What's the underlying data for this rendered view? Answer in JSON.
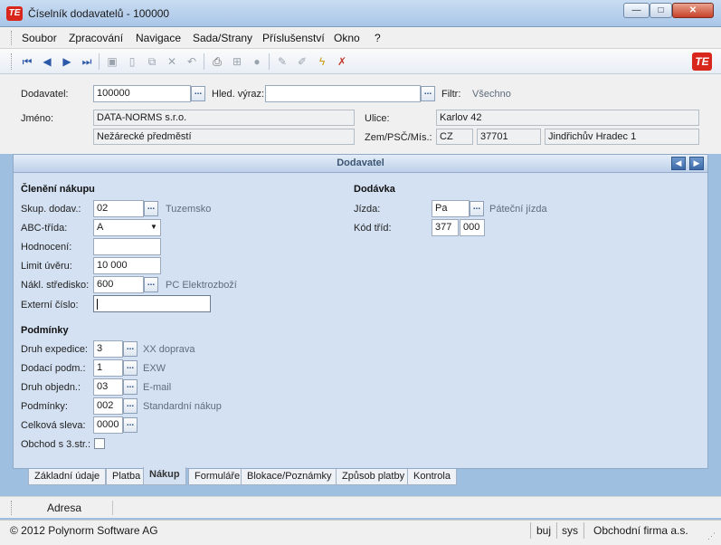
{
  "window": {
    "title": "Číselník dodavatelů - 100000",
    "logo": "TE",
    "minimize": "—",
    "maximize": "□",
    "close": "✕"
  },
  "menu": [
    "Soubor",
    "Zpracování",
    "Navigace",
    "Sada/Strany",
    "Příslušenství",
    "Okno",
    "?"
  ],
  "toolbar": {
    "icons": [
      "first-record-icon",
      "prev-record-icon",
      "next-record-icon",
      "last-record-icon",
      "save-icon",
      "new-icon",
      "copy-icon",
      "delete-icon",
      "undo-icon",
      "print-icon",
      "tree-icon",
      "disc-icon",
      "edit-icon",
      "edit2-icon",
      "magic-icon",
      "cancel-filter-icon"
    ]
  },
  "header": {
    "dodavatel_label": "Dodavatel:",
    "dodavatel_value": "100000",
    "hled_label": "Hled. výraz:",
    "hled_value": "",
    "filtr_label": "Filtr:",
    "filtr_value": "Všechno",
    "jmeno_label": "Jméno:",
    "jmeno_line1": "DATA-NORMS s.r.o.",
    "jmeno_line2": "Nežárecké předměstí",
    "ulice_label": "Ulice:",
    "ulice_value": "Karlov 42",
    "zem_label": "Zem/PSČ/Mís.:",
    "zem_value": "CZ",
    "psc_value": "37701",
    "misto_value": "Jindřichův Hradec 1"
  },
  "panel": {
    "title": "Dodavatel",
    "cleneni": {
      "heading": "Členění nákupu",
      "skup_label": "Skup. dodav.:",
      "skup_value": "02",
      "skup_hint": "Tuzemsko",
      "abc_label": "ABC-třída:",
      "abc_value": "A",
      "hodnoceni_label": "Hodnocení:",
      "hodnoceni_value": "",
      "limit_label": "Limit úvěru:",
      "limit_value": "10 000",
      "nakl_label": "Nákl. středisko:",
      "nakl_value": "600",
      "nakl_hint": "PC Elektrozboží",
      "externi_label": "Externí číslo:",
      "externi_value": ""
    },
    "podminky": {
      "heading": "Podmínky",
      "expedice_label": "Druh expedice:",
      "expedice_value": "3",
      "expedice_hint": "XX doprava",
      "dodaci_label": "Dodací podm.:",
      "dodaci_value": "1",
      "dodaci_hint": "EXW",
      "objedn_label": "Druh objedn.:",
      "objedn_value": "03",
      "objedn_hint": "E-mail",
      "podm_label": "Podmínky:",
      "podm_value": "002",
      "podm_hint": "Standardní nákup",
      "sleva_label": "Celková sleva:",
      "sleva_value": "0000",
      "obchod_label": "Obchod s 3.str.:"
    },
    "dodavka": {
      "heading": "Dodávka",
      "jizda_label": "Jízda:",
      "jizda_value": "Pa",
      "jizda_hint": "Páteční jízda",
      "kod_label": "Kód tříd:",
      "kod_value1": "377",
      "kod_value2": "000"
    }
  },
  "tabs": [
    "Základní údaje",
    "Platba",
    "Nákup",
    "Formuláře",
    "Blokace/Poznámky",
    "Způsob platby",
    "Kontrola"
  ],
  "active_tab": "Nákup",
  "address_bar": "Adresa",
  "status": {
    "copyright": "© 2012 Polynorm Software AG",
    "user": "buj",
    "db": "sys",
    "company": "Obchodní firma a.s."
  },
  "colors": {
    "panel_bg": "#d4e1f2",
    "title_gradient": "#a9c6e8",
    "logo": "#d9261c"
  }
}
